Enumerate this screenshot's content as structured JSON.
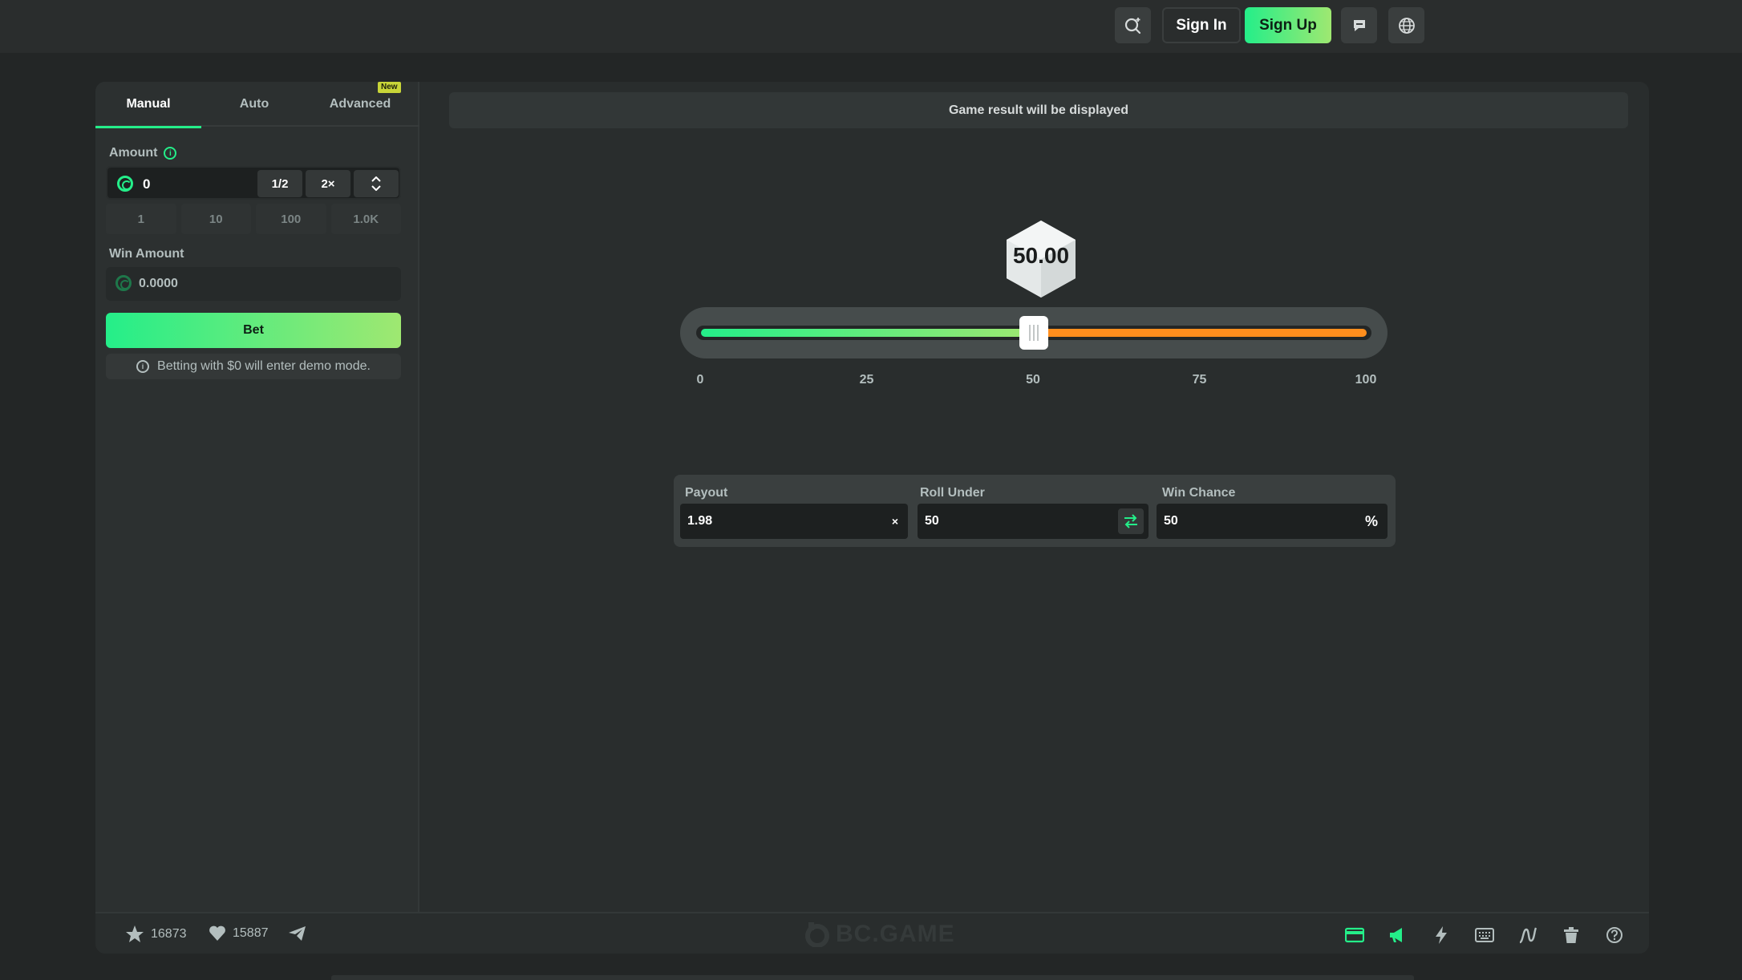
{
  "header": {
    "signin_label": "Sign In",
    "signup_label": "Sign Up",
    "icons": [
      "search-icon",
      "chat-icon",
      "globe-icon"
    ]
  },
  "bet_panel": {
    "tabs": [
      {
        "label": "Manual",
        "active": true
      },
      {
        "label": "Auto",
        "active": false
      },
      {
        "label": "Advanced",
        "active": false,
        "badge": "New"
      }
    ],
    "amount_label": "Amount",
    "amount_value": "0",
    "half_label": "1/2",
    "double_label": "2×",
    "quick_amounts": [
      "1",
      "10",
      "100",
      "1.0K"
    ],
    "win_amount_label": "Win Amount",
    "win_amount_value": "0.0000",
    "bet_label": "Bet",
    "demo_note": "Betting with $0 will enter demo mode."
  },
  "game": {
    "result_text": "Game result will be displayed",
    "dice_value": "50.00",
    "slider": {
      "min": 0,
      "max": 100,
      "value": 50,
      "ticks": [
        "0",
        "25",
        "50",
        "75",
        "100"
      ]
    },
    "payout_label": "Payout",
    "payout_value": "1.98",
    "payout_suffix": "×",
    "roll_label": "Roll Under",
    "roll_value": "50",
    "chance_label": "Win Chance",
    "chance_value": "50",
    "chance_suffix": "%"
  },
  "footer": {
    "likes": "16873",
    "hearts": "15887",
    "logo": "BC.GAME",
    "icons": [
      "card-icon",
      "megaphone-icon",
      "lightning-icon",
      "keyboard-icon",
      "chart-icon",
      "trash-icon",
      "help-icon"
    ]
  },
  "colors": {
    "accent_green": "#24ee89",
    "accent_orange": "#ff8e1d",
    "background": "#232626"
  }
}
